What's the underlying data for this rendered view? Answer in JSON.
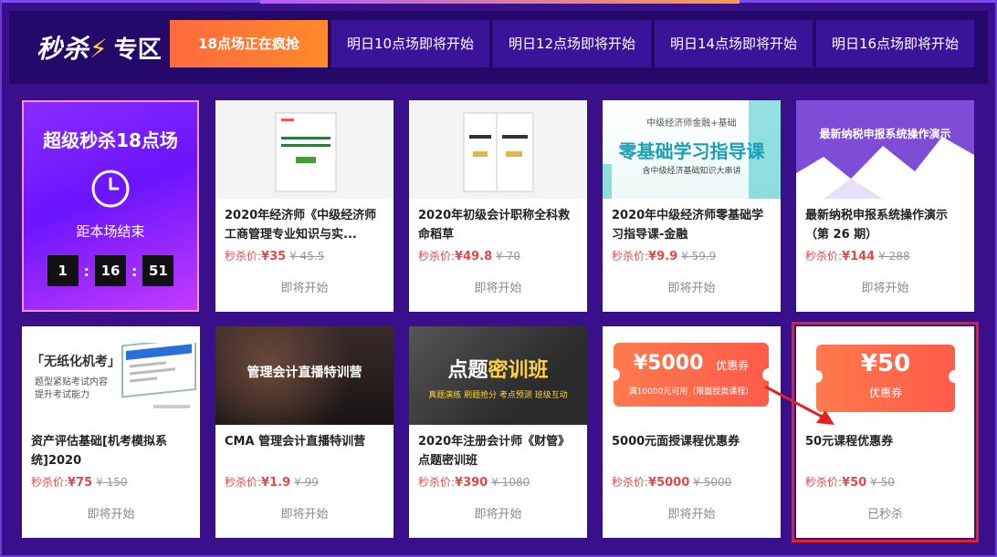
{
  "header": {
    "brand_part1": "秒杀",
    "brand_part2": "专区",
    "tabs": [
      {
        "label": "18点场正在疯抢"
      },
      {
        "label": "明日10点场即将开始"
      },
      {
        "label": "明日12点场即将开始"
      },
      {
        "label": "明日14点场即将开始"
      },
      {
        "label": "明日16点场即将开始"
      }
    ]
  },
  "feature": {
    "title": "超级秒杀18点场",
    "subtitle": "距本场结束",
    "timer": [
      "1",
      "16",
      "51"
    ],
    "sep": ":"
  },
  "price_label": "秒杀价:",
  "cards": [
    {
      "name": "2020年经济师《中级经济师工商管理专业知识与实...",
      "price": "¥35",
      "original": "¥ 45.5",
      "action": "即将开始"
    },
    {
      "name": "2020年初级会计职称全科救命稻草",
      "price": "¥49.8",
      "original": "¥ 70",
      "action": "即将开始"
    },
    {
      "name": "2020年中级经济师零基础学习指导课-金融",
      "price": "¥9.9",
      "original": "¥ 59.9",
      "action": "即将开始",
      "thumb_top": "中级经济师金融+基础",
      "thumb_main": "零基础学习指导课",
      "thumb_sub": "含中级经济基础知识大串讲"
    },
    {
      "name": "最新纳税申报系统操作演示（第 26 期）",
      "price": "¥144",
      "original": "¥ 288",
      "action": "即将开始",
      "thumb_text": "最新纳税申报系统操作演示"
    },
    {
      "name": "资产评估基础[机考模拟系统]2020",
      "price": "¥75",
      "original": "¥ 150",
      "action": "即将开始",
      "thumb_title": "「无纸化机考」",
      "thumb_sub1": "题型紧贴考试内容",
      "thumb_sub2": "提升考试能力"
    },
    {
      "name": "CMA 管理会计直播特训营",
      "price": "¥1.9",
      "original": "¥ 99",
      "action": "即将开始",
      "thumb_text": "管理会计直播特训营"
    },
    {
      "name": "2020年注册会计师《财管》点题密训班",
      "price": "¥390",
      "original": "¥ 1080",
      "action": "即将开始",
      "thumb_main_a": "点题",
      "thumb_main_b": "密训班",
      "thumb_sub": "真题演练  刷题抢分  考点预测  班级互动"
    },
    {
      "name": "5000元面授课程优惠券",
      "price": "¥5000",
      "original": "¥ 5000",
      "action": "即将开始",
      "coupon_amount": "¥5000",
      "coupon_unit": "优惠券",
      "coupon_note": "满10000元可用（限面授类课程）"
    },
    {
      "name": "50元课程优惠券",
      "price": "¥50",
      "original": "¥ 50",
      "action": "已秒杀",
      "coupon_amount": "¥50",
      "coupon_unit": "优惠券"
    }
  ],
  "colors": {
    "accent": "#ff6a3d",
    "price": "#e8474a",
    "highlight": "#e52020"
  }
}
